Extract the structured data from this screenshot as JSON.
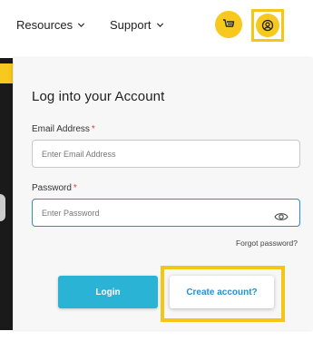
{
  "header": {
    "nav_items": [
      {
        "label": "Resources"
      },
      {
        "label": "Support"
      }
    ],
    "cart_icon": "cart-icon",
    "account_icon": "user-circle-icon",
    "accent_color": "#f7c81e",
    "highlight_color": "#f5c518"
  },
  "login_form": {
    "title": "Log into your Account",
    "email": {
      "label": "Email Address",
      "required_mark": "*",
      "placeholder": "Enter Email Address",
      "value": ""
    },
    "password": {
      "label": "Password",
      "required_mark": "*",
      "placeholder": "Enter Password",
      "value": "",
      "toggle_icon": "eye-icon"
    },
    "forgot_password": "Forgot password?",
    "login_button": "Login",
    "create_account_button": "Create account?",
    "primary_color": "#2bb3d6",
    "link_color": "#2a8fc9",
    "required_color": "#e23b3b"
  }
}
